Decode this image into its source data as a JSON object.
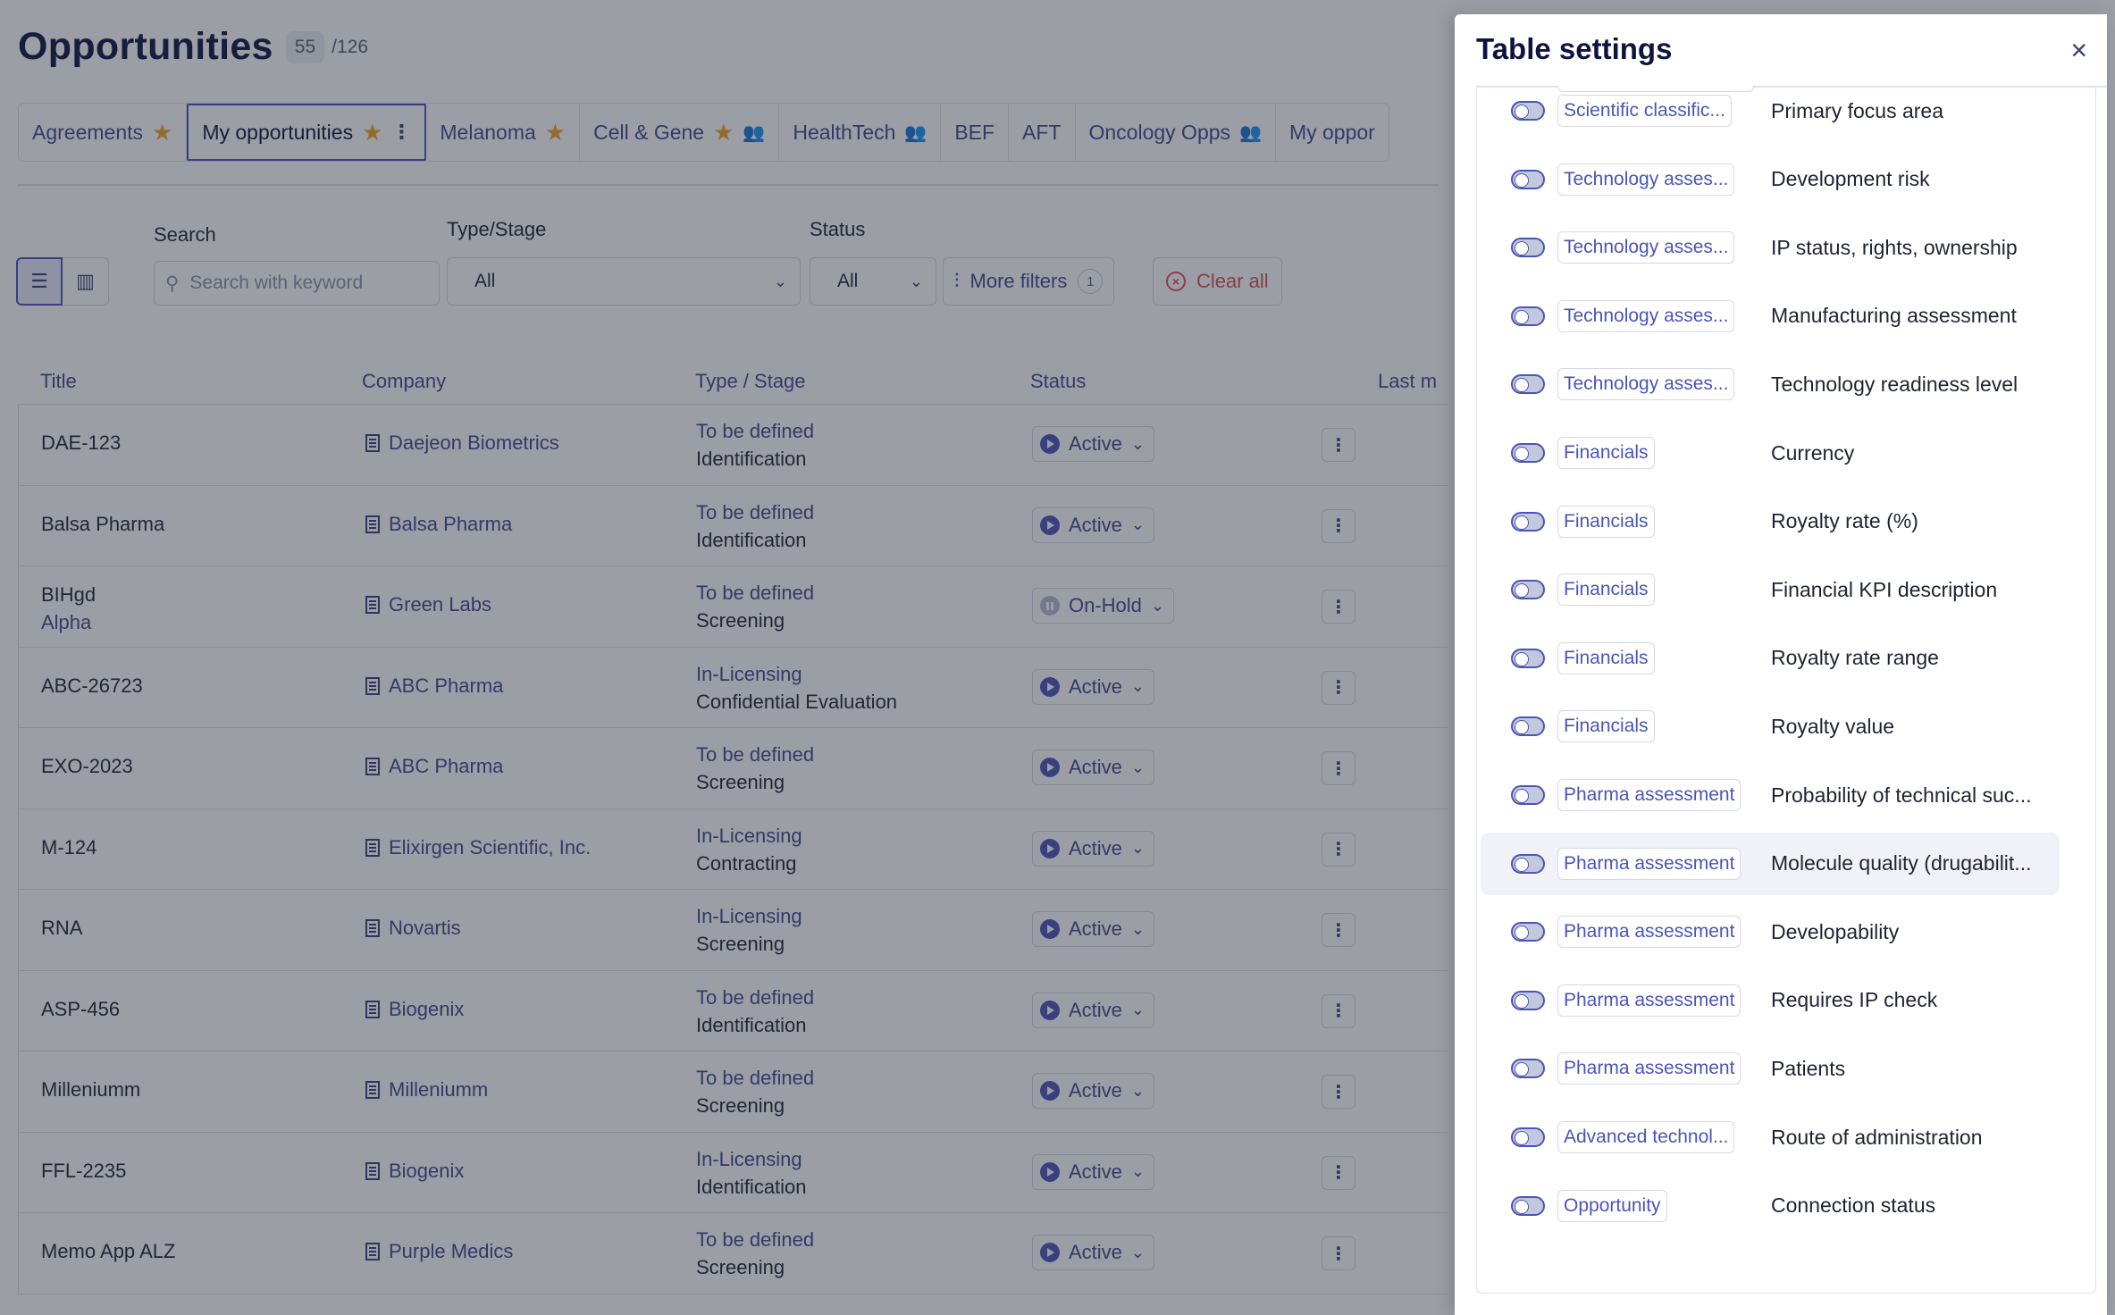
{
  "page": {
    "title": "Opportunities",
    "count": "55",
    "total": "/126"
  },
  "tabs": [
    {
      "label": "Agreements",
      "icon": "star-icon"
    },
    {
      "label": "My opportunities",
      "icon": "star-icon",
      "active": true
    },
    {
      "label": "Melanoma",
      "icon": "star-icon"
    },
    {
      "label": "Cell & Gene",
      "icon": "star-icon",
      "shared": true
    },
    {
      "label": "HealthTech",
      "shared": true
    },
    {
      "label": "BEF"
    },
    {
      "label": "AFT"
    },
    {
      "label": "Oncology Opps",
      "shared": true
    },
    {
      "label": "My oppor"
    }
  ],
  "filters": {
    "search_label": "Search",
    "search_placeholder": "Search with keyword",
    "type_label": "Type/Stage",
    "type_value": "All",
    "status_label": "Status",
    "status_value": "All",
    "more_filters": "More filters",
    "more_filters_count": "1",
    "clear_all": "Clear all"
  },
  "table": {
    "columns": [
      "Title",
      "Company",
      "Type / Stage",
      "Status",
      "Last m"
    ],
    "rows": [
      {
        "title": "DAE-123",
        "subtitle": "",
        "company": "Daejeon Biometrics",
        "type": "To be defined",
        "stage": "Identification",
        "status": "Active"
      },
      {
        "title": "Balsa Pharma",
        "subtitle": "",
        "company": "Balsa Pharma",
        "type": "To be defined",
        "stage": "Identification",
        "status": "Active"
      },
      {
        "title": "BIHgd",
        "subtitle": "Alpha",
        "company": "Green Labs",
        "type": "To be defined",
        "stage": "Screening",
        "status": "On-Hold"
      },
      {
        "title": "ABC-26723",
        "subtitle": "",
        "company": "ABC Pharma",
        "type": "In-Licensing",
        "stage": "Confidential Evaluation",
        "status": "Active"
      },
      {
        "title": "EXO-2023",
        "subtitle": "",
        "company": "ABC Pharma",
        "type": "To be defined",
        "stage": "Screening",
        "status": "Active"
      },
      {
        "title": "M-124",
        "subtitle": "",
        "company": "Elixirgen Scientific, Inc.",
        "type": "In-Licensing",
        "stage": "Contracting",
        "status": "Active"
      },
      {
        "title": "RNA",
        "subtitle": "",
        "company": "Novartis",
        "type": "In-Licensing",
        "stage": "Screening",
        "status": "Active"
      },
      {
        "title": "ASP-456",
        "subtitle": "",
        "company": "Biogenix",
        "type": "To be defined",
        "stage": "Identification",
        "status": "Active"
      },
      {
        "title": "Milleniumm",
        "subtitle": "",
        "company": "Milleniumm",
        "type": "To be defined",
        "stage": "Screening",
        "status": "Active"
      },
      {
        "title": "FFL-2235",
        "subtitle": "",
        "company": "Biogenix",
        "type": "In-Licensing",
        "stage": "Identification",
        "status": "Active"
      },
      {
        "title": "Memo App ALZ",
        "subtitle": "",
        "company": "Purple Medics",
        "type": "To be defined",
        "stage": "Screening",
        "status": "Active"
      }
    ]
  },
  "drawer": {
    "title": "Table settings",
    "items": [
      {
        "category": "Scientific classific...",
        "label": "Primary focus area"
      },
      {
        "category": "Technology asses...",
        "label": "Development risk"
      },
      {
        "category": "Technology asses...",
        "label": "IP status, rights, ownership"
      },
      {
        "category": "Technology asses...",
        "label": "Manufacturing assessment"
      },
      {
        "category": "Technology asses...",
        "label": "Technology readiness level"
      },
      {
        "category": "Financials",
        "label": "Currency"
      },
      {
        "category": "Financials",
        "label": "Royalty rate (%)"
      },
      {
        "category": "Financials",
        "label": "Financial KPI description"
      },
      {
        "category": "Financials",
        "label": "Royalty rate range"
      },
      {
        "category": "Financials",
        "label": "Royalty value"
      },
      {
        "category": "Pharma assessment",
        "label": "Probability of technical suc..."
      },
      {
        "category": "Pharma assessment",
        "label": "Molecule quality (drugabilit...",
        "highlighted": true
      },
      {
        "category": "Pharma assessment",
        "label": "Developability"
      },
      {
        "category": "Pharma assessment",
        "label": "Requires IP check"
      },
      {
        "category": "Pharma assessment",
        "label": "Patients"
      },
      {
        "category": "Advanced technol...",
        "label": "Route of administration"
      },
      {
        "category": "Opportunity",
        "label": "Connection status"
      }
    ]
  },
  "colors": {
    "accent": "#4a55b7",
    "title": "#0d1440",
    "star": "#f0a425",
    "danger": "#d9534f",
    "overlay": "rgba(36,40,58,0.45)"
  }
}
